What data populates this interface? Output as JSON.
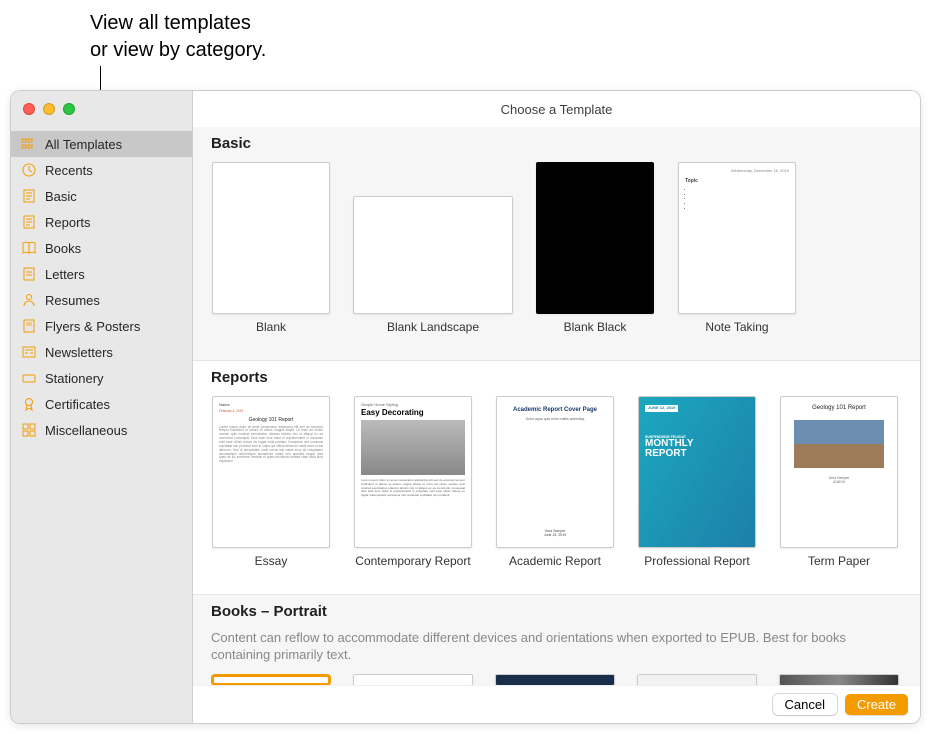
{
  "callout": "View all templates\nor view by category.",
  "window_title": "Choose a Template",
  "sidebar": {
    "items": [
      {
        "label": "All Templates",
        "icon": "grid-icon",
        "selected": true
      },
      {
        "label": "Recents",
        "icon": "clock-icon"
      },
      {
        "label": "Basic",
        "icon": "page-icon"
      },
      {
        "label": "Reports",
        "icon": "page-icon"
      },
      {
        "label": "Books",
        "icon": "book-icon"
      },
      {
        "label": "Letters",
        "icon": "page-icon"
      },
      {
        "label": "Resumes",
        "icon": "person-icon"
      },
      {
        "label": "Flyers & Posters",
        "icon": "poster-icon"
      },
      {
        "label": "Newsletters",
        "icon": "newspaper-icon"
      },
      {
        "label": "Stationery",
        "icon": "card-icon"
      },
      {
        "label": "Certificates",
        "icon": "ribbon-icon"
      },
      {
        "label": "Miscellaneous",
        "icon": "grid4-icon"
      }
    ]
  },
  "sections": {
    "basic": {
      "title": "Basic",
      "templates": [
        {
          "label": "Blank"
        },
        {
          "label": "Blank Landscape"
        },
        {
          "label": "Blank Black"
        },
        {
          "label": "Note Taking"
        }
      ]
    },
    "reports": {
      "title": "Reports",
      "templates": [
        {
          "label": "Essay"
        },
        {
          "label": "Contemporary Report"
        },
        {
          "label": "Academic Report"
        },
        {
          "label": "Professional Report"
        },
        {
          "label": "Term Paper"
        }
      ]
    },
    "books": {
      "title": "Books – Portrait",
      "subtitle": "Content can reflow to accommodate different devices and orientations when exported to EPUB. Best for books containing primarily text."
    }
  },
  "buttons": {
    "cancel": "Cancel",
    "create": "Create"
  },
  "note_thumb": {
    "date": "Wednesday, December 18, 2019",
    "title": "Topic"
  },
  "essay_thumb": {
    "name": "Name",
    "date": "February 4, 2019",
    "title": "Geology 101 Report"
  },
  "contemp_thumb": {
    "sup": "Simple Home Styling",
    "title": "Easy Decorating"
  },
  "acad_thumb": {
    "title": "Academic Report Cover Page",
    "sub": "Dolor aqua quis enim mallis aciendiqs"
  },
  "prof_thumb": {
    "date": "JUNE 12, 2019",
    "sup": "SUSPENDISSE FEUGIAT",
    "title": "MONTHLY REPORT"
  },
  "term_thumb": {
    "title": "Geology 101 Report",
    "author": "Urna Semper"
  }
}
